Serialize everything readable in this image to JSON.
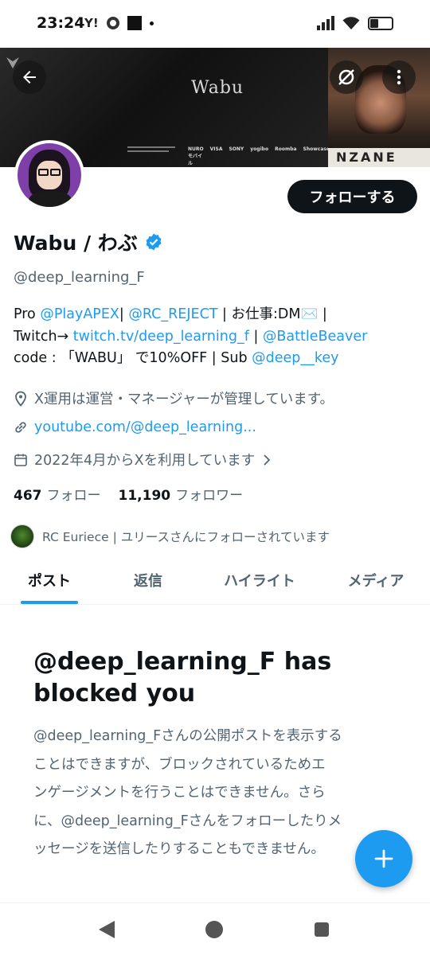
{
  "status_bar": {
    "time": "23:24",
    "yahoo_label": "Y!"
  },
  "banner": {
    "title": "Wabu",
    "sponsors": [
      "NUROモバイル",
      "VISA",
      "SONY",
      "yogibo",
      "Roomba",
      "Showcase"
    ],
    "side_plate": "NZANE"
  },
  "profile": {
    "follow_label": "フォローする",
    "name": "Wabu / わぶ",
    "handle": "@deep_learning_F",
    "bio": {
      "l1_pre": "Pro ",
      "l1_link1": "@PlayAPEX",
      "l1_sep": "| ",
      "l1_link2": "@RC_REJECT",
      "l1_post": " | お仕事:DM✉️ |",
      "l2_pre": "Twitch→ ",
      "l2_link1": "twitch.tv/deep_learning_f",
      "l2_sep": " | ",
      "l2_link2": "@BattleBeaver",
      "l3_pre": "code : 「WABU」 で10%OFF | Sub ",
      "l3_link": "@deep__key"
    },
    "location": "X運用は運営・マネージャーが管理しています。",
    "url": "youtube.com/@deep_learning...",
    "joined": "2022年4月からXを利用しています",
    "following_count": "467",
    "following_label": "フォロー",
    "followers_count": "11,190",
    "followers_label": "フォロワー",
    "followed_by": "RC Euriece | ユリースさんにフォローされています"
  },
  "tabs": [
    {
      "label": "ポスト",
      "active": true
    },
    {
      "label": "返信",
      "active": false
    },
    {
      "label": "ハイライト",
      "active": false
    },
    {
      "label": "メディア",
      "active": false
    }
  ],
  "blocked": {
    "title_l1": "@deep_learning_F has",
    "title_l2": "blocked you",
    "body_l1": "@deep_learning_Fさんの公開ポストを表示する",
    "body_l2": "ことはできますが、ブロックされているためエ",
    "body_l3": "ンゲージメントを行うことはできません。さら",
    "body_l4": "に、@deep_learning_Fさんをフォローしたりメ",
    "body_l5": "ッセージを送信したりすることもできません。"
  },
  "icons": {
    "back": "arrow-left-icon",
    "grok": "grok-icon",
    "more": "more-vertical-icon",
    "verified": "verified-badge-icon",
    "location": "location-pin-icon",
    "link": "link-icon",
    "calendar": "calendar-icon",
    "fab": "plus-icon"
  },
  "colors": {
    "accent": "#1d9bf0",
    "text": "#0f1419",
    "secondary": "#536471"
  }
}
